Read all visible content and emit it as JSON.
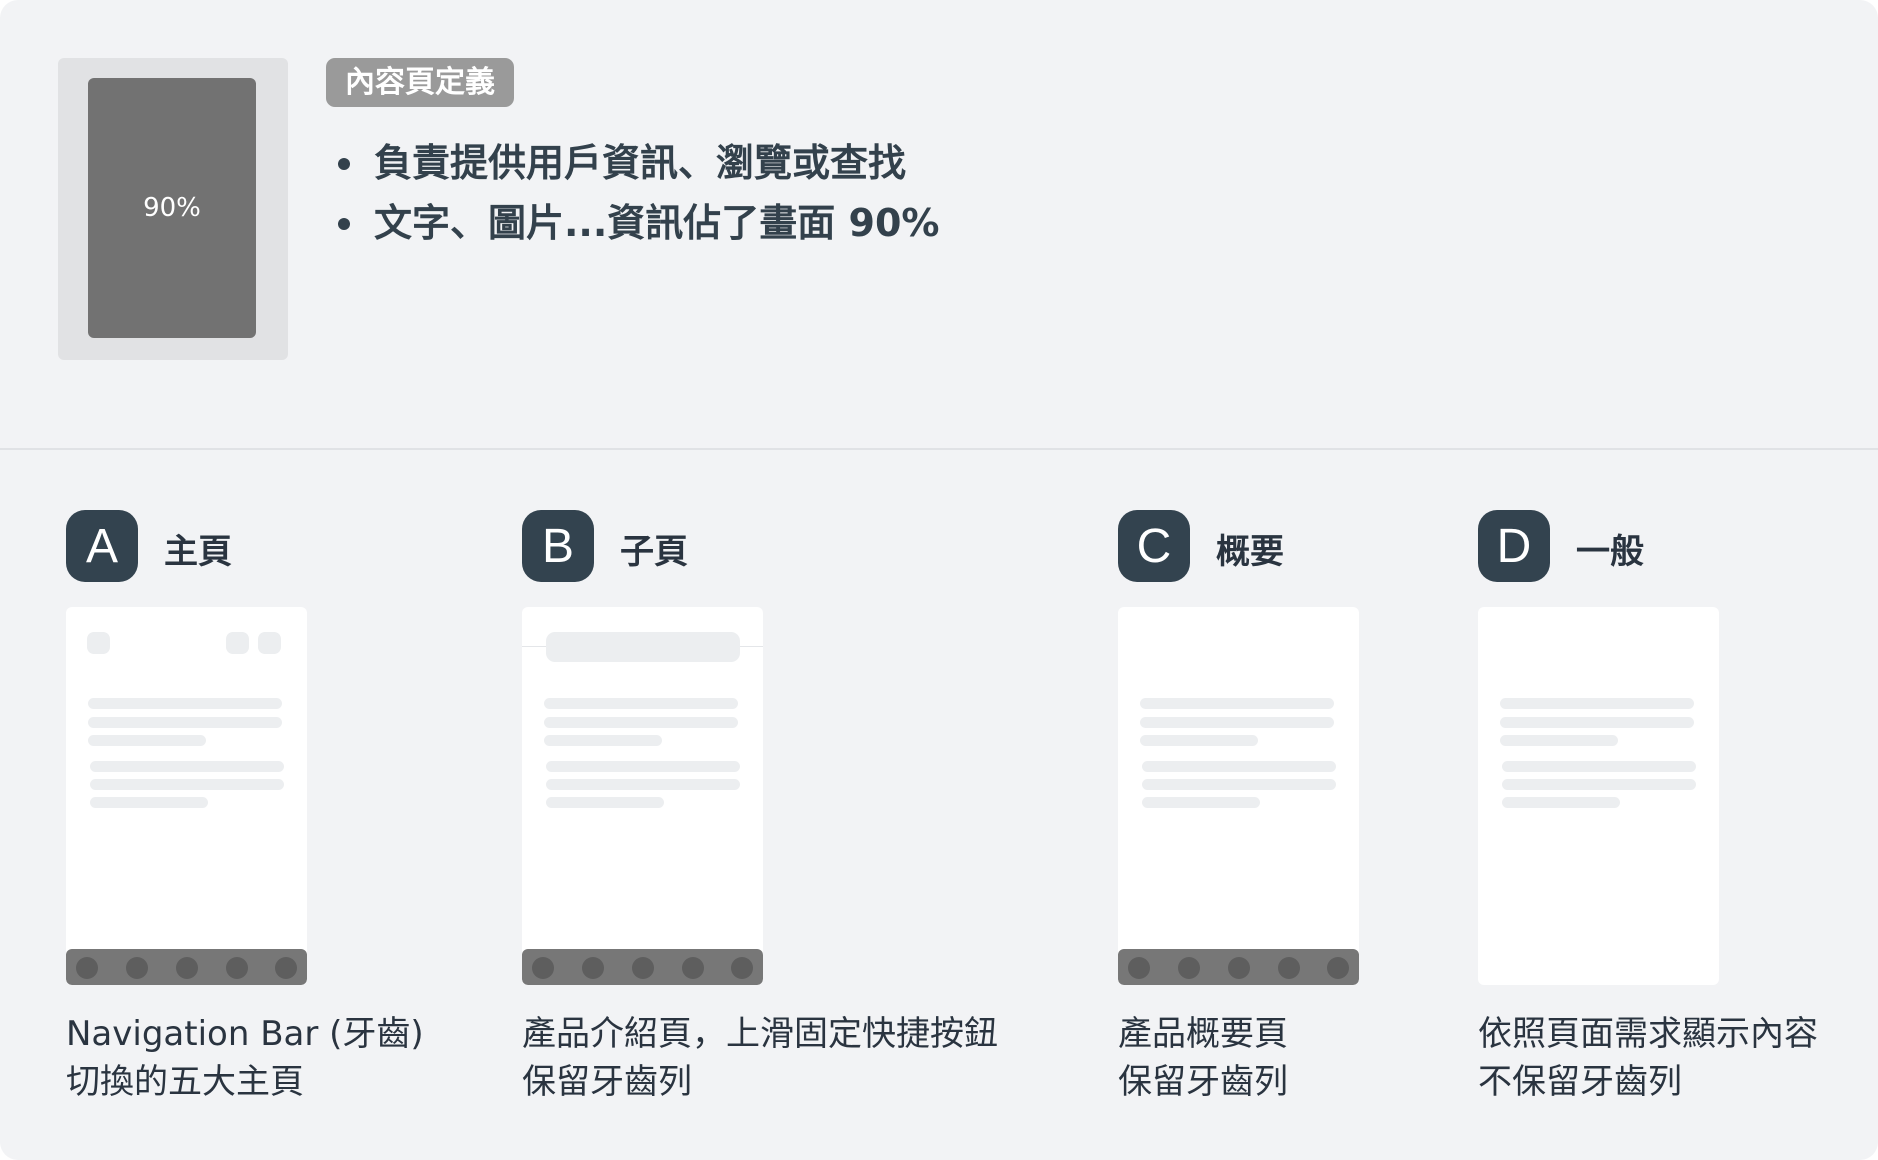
{
  "definition": {
    "thumbnail_label": "90%",
    "tag": "內容頁定義",
    "points": [
      "負責提供用戶資訊、瀏覽或查找",
      "文字、圖片...資訊佔了畫面 90%"
    ]
  },
  "page_types": [
    {
      "letter": "A",
      "title": "主頁",
      "description": [
        "Navigation Bar (牙齒)",
        "切換的五大主頁"
      ],
      "has_nav_bar": true
    },
    {
      "letter": "B",
      "title": "子頁",
      "description": [
        "產品介紹頁，上滑固定快捷按鈕",
        "保留牙齒列"
      ],
      "has_nav_bar": true
    },
    {
      "letter": "C",
      "title": "概要",
      "description": [
        "產品概要頁",
        "保留牙齒列"
      ],
      "has_nav_bar": true
    },
    {
      "letter": "D",
      "title": "一般",
      "description": [
        "依照頁面需求顯示內容",
        "不保留牙齒列"
      ],
      "has_nav_bar": false
    }
  ],
  "colors": {
    "background": "#f2f3f5",
    "badge": "#33434f",
    "thumbnail": "#727272",
    "nav_bar": "#777777",
    "tag": "#9a9a9a"
  }
}
